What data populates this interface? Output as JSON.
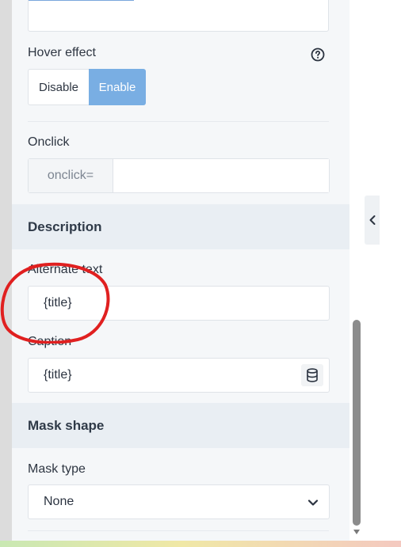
{
  "hover_effect": {
    "label": "Hover effect",
    "options": [
      "Disable",
      "Enable"
    ],
    "selected": "Enable",
    "help_icon": "question-circle-icon"
  },
  "onclick": {
    "label": "Onclick",
    "prefix": "onclick=",
    "value": ""
  },
  "description": {
    "section_title": "Description",
    "alternate_text": {
      "label": "Alternate text",
      "value": "{title}"
    },
    "caption": {
      "label": "Caption",
      "value": "{title}",
      "icon": "database-icon"
    }
  },
  "mask": {
    "section_title": "Mask shape",
    "type_label": "Mask type",
    "type_value": "None"
  },
  "colors": {
    "accent": "#79aee3",
    "annotation": "#e02020",
    "panel_bg": "#f5f7f9",
    "section_bg": "#e9eef3"
  }
}
